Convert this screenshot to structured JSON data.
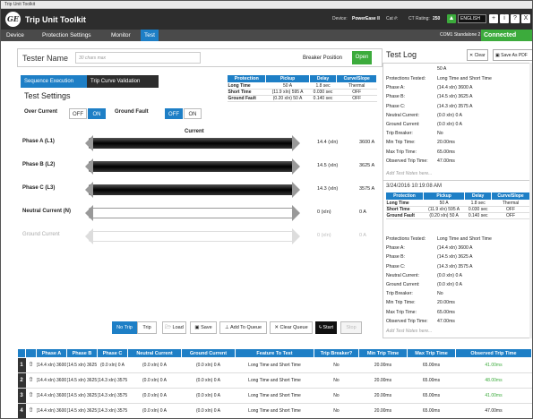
{
  "window": {
    "title": "Trip Unit Toolkit"
  },
  "header": {
    "logo": "GE",
    "title": "Trip Unit Toolkit",
    "device_label": "Device:",
    "device_value": "PowerEase II",
    "cat_label": "Cat #:",
    "ct_label": "CT Rating:",
    "ct_value": "250",
    "language": "ENGLISH",
    "buttons": [
      "+",
      "i",
      "?",
      "X"
    ]
  },
  "menu": {
    "items": [
      "Device",
      "Protection Settings",
      "Monitor",
      "Test"
    ],
    "active": "Test",
    "com": "COM1 Standalone 2",
    "status": "Connected"
  },
  "tester": {
    "label": "Tester Name",
    "placeholder": "30 chars max",
    "breaker_position_label": "Breaker Position",
    "breaker_position_value": "Open"
  },
  "tabs": {
    "sequence": "Sequence Execution",
    "curve": "Trip Curve Validation"
  },
  "settings": {
    "title": "Test Settings",
    "over_current_label": "Over Current",
    "ground_fault_label": "Ground Fault",
    "off": "OFF",
    "on": "ON"
  },
  "protection_table": {
    "headers": [
      "Protection",
      "Pickup",
      "Delay",
      "Curve/Slope"
    ],
    "rows": [
      {
        "name": "Long Time",
        "pickup": "50 A",
        "delay": "1.8 sec",
        "curve": "Thermal"
      },
      {
        "name": "Short Time",
        "pickup": "(11.9 xIn) 595 A",
        "delay": "0.030 sec",
        "curve": "OFF"
      },
      {
        "name": "Ground Fault",
        "pickup": "(0.20 xIn) 50 A",
        "delay": "0.140 sec",
        "curve": "OFF"
      }
    ]
  },
  "current": {
    "title": "Current",
    "phases": [
      {
        "name": "Phase A  (L1)",
        "xin": "14.4  (xIn)",
        "amps": "3600 A",
        "active": true
      },
      {
        "name": "Phase B  (L2)",
        "xin": "14.5  (xIn)",
        "amps": "3625 A",
        "active": true
      },
      {
        "name": "Phase C  (L3)",
        "xin": "14.3  (xIn)",
        "amps": "3575 A",
        "active": true
      },
      {
        "name": "Neutral Current  (N)",
        "xin": "0  (xIn)",
        "amps": "0 A",
        "active": false
      },
      {
        "name": "Ground Current",
        "xin": "0  (xIn)",
        "amps": "0 A",
        "active": false,
        "disabled": true
      }
    ]
  },
  "buttons": {
    "no_trip": "No Trip",
    "trip": "Trip",
    "load": "Load",
    "save": "Save",
    "add_to_queue": "Add To Queue",
    "clear_queue": "Clear Queue",
    "start": "Start",
    "stop": "Stop"
  },
  "log": {
    "title": "Test Log",
    "clear": "Clear",
    "save_pdf": "Save As PDF",
    "entries": [
      {
        "top_fragment": "50 A",
        "lines": [
          {
            "k": "Protections Tested:",
            "v": "Long Time and Short Time"
          },
          {
            "k": "Phase A:",
            "v": "(14.4 xIn) 3600 A"
          },
          {
            "k": "Phase B:",
            "v": "(14.5 xIn) 3625 A"
          },
          {
            "k": "Phase C:",
            "v": "(14.3 xIn) 3575 A"
          },
          {
            "k": "Neutral Current:",
            "v": "(0.0 xIn) 0 A"
          },
          {
            "k": "Ground Current:",
            "v": "(0.0 xIn) 0 A"
          },
          {
            "k": "Trip Breaker:",
            "v": "No"
          },
          {
            "k": "Min Trip Time:",
            "v": "20.00ms"
          },
          {
            "k": "Max Trip Time:",
            "v": "65.00ms"
          },
          {
            "k": "Observed Trip Time:",
            "v": "47.00ms"
          }
        ],
        "notes": "Add Test Notes here..."
      },
      {
        "date": "3/24/2016 10:19:08 AM",
        "lines": [
          {
            "k": "Protections Tested:",
            "v": "Long Time and Short Time"
          },
          {
            "k": "Phase A:",
            "v": "(14.4 xIn) 3600 A"
          },
          {
            "k": "Phase B:",
            "v": "(14.5 xIn) 3625 A"
          },
          {
            "k": "Phase C:",
            "v": "(14.3 xIn) 3575 A"
          },
          {
            "k": "Neutral Current:",
            "v": "(0.0 xIn) 0 A"
          },
          {
            "k": "Ground Current:",
            "v": "(0.0 xIn) 0 A"
          },
          {
            "k": "Trip Breaker:",
            "v": "No"
          },
          {
            "k": "Min Trip Time:",
            "v": "20.00ms"
          },
          {
            "k": "Max Trip Time:",
            "v": "65.00ms"
          },
          {
            "k": "Observed Trip Time:",
            "v": "47.00ms"
          }
        ],
        "notes": "Add Test Notes here..."
      }
    ]
  },
  "queue": {
    "headers": [
      "Phase A",
      "Phase B",
      "Phase C",
      "Neutral Current",
      "Ground Current",
      "Feature To Test",
      "Trip Breaker?",
      "Min Trip Time",
      "Max Trip Time",
      "Observed Trip Time"
    ],
    "rows": [
      {
        "n": "1",
        "a": "(14.4 xIn) 3600 A",
        "b": "(14.5 xIn) 3625 A",
        "c": "(0.0 xIn) 0 A",
        "neutral": "(0.0 xIn) 0 A",
        "ground": "(0.0 xIn) 0 A",
        "feature": "Long Time and Short Time",
        "trip": "No",
        "min": "20.00ms",
        "max": "65.00ms",
        "obs": "41.00ms",
        "obs_green": true
      },
      {
        "n": "2",
        "a": "(14.4 xIn) 3600 A",
        "b": "(14.5 xIn) 3625 A",
        "c": "(14.3 xIn) 3575 A",
        "neutral": "(0.0 xIn) 0 A",
        "ground": "(0.0 xIn) 0 A",
        "feature": "Long Time and Short Time",
        "trip": "No",
        "min": "20.00ms",
        "max": "65.00ms",
        "obs": "48.00ms",
        "obs_green": true
      },
      {
        "n": "3",
        "a": "(14.4 xIn) 3600 A",
        "b": "(14.5 xIn) 3625 A",
        "c": "(14.3 xIn) 3575 A",
        "neutral": "(0.0 xIn) 0 A",
        "ground": "(0.0 xIn) 0 A",
        "feature": "Long Time and Short Time",
        "trip": "No",
        "min": "20.00ms",
        "max": "65.00ms",
        "obs": "41.00ms",
        "obs_green": true
      },
      {
        "n": "4",
        "a": "(14.4 xIn) 3600 A",
        "b": "(14.5 xIn) 3625 A",
        "c": "(14.3 xIn) 3575 A",
        "neutral": "(0.0 xIn) 0 A",
        "ground": "(0.0 xIn) 0 A",
        "feature": "Long Time and Short Time",
        "trip": "No",
        "min": "20.00ms",
        "max": "65.00ms",
        "obs": "47.00ms",
        "obs_green": false
      }
    ]
  },
  "colors": {
    "accent": "#1e7fc6",
    "success": "#3cab3c",
    "header": "#2d2d2d"
  }
}
